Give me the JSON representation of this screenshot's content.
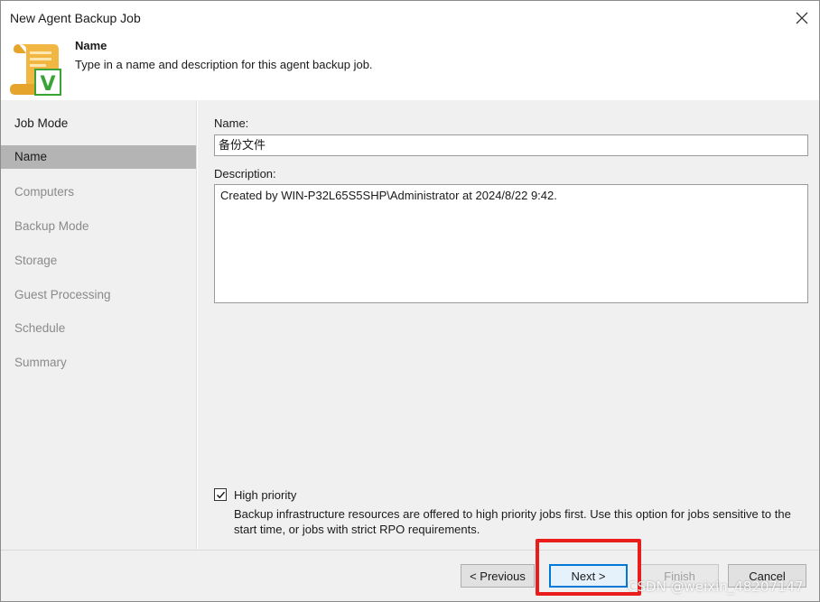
{
  "window": {
    "title": "New Agent Backup Job",
    "close_glyph": "✕"
  },
  "header": {
    "title": "Name",
    "description": "Type in a name and description for this agent backup job.",
    "logo_icon": "veeam-scroll-icon",
    "logo_letter": "V"
  },
  "sidebar": {
    "items": [
      {
        "label": "Job Mode",
        "state": "done"
      },
      {
        "label": "Name",
        "state": "active"
      },
      {
        "label": "Computers",
        "state": "pending"
      },
      {
        "label": "Backup Mode",
        "state": "pending"
      },
      {
        "label": "Storage",
        "state": "pending"
      },
      {
        "label": "Guest Processing",
        "state": "pending"
      },
      {
        "label": "Schedule",
        "state": "pending"
      },
      {
        "label": "Summary",
        "state": "pending"
      }
    ]
  },
  "form": {
    "name_label": "Name:",
    "name_value": "备份文件",
    "description_label": "Description:",
    "description_value": "Created by WIN-P32L65S5SHP\\Administrator at 2024/8/22 9:42.",
    "high_priority_label": "High priority",
    "high_priority_checked": true,
    "high_priority_description": "Backup infrastructure resources are offered to high priority jobs first. Use this option for jobs sensitive to the start time, or jobs with strict RPO requirements."
  },
  "footer": {
    "previous_label": "< Previous",
    "next_label": "Next >",
    "finish_label": "Finish",
    "cancel_label": "Cancel"
  },
  "watermark": "CSDN @weixin_48207147",
  "colors": {
    "accent": "#0078d7",
    "highlight": "#ea1c1c",
    "active_item": "#b4b4b4",
    "panel": "#f0f0f0"
  }
}
